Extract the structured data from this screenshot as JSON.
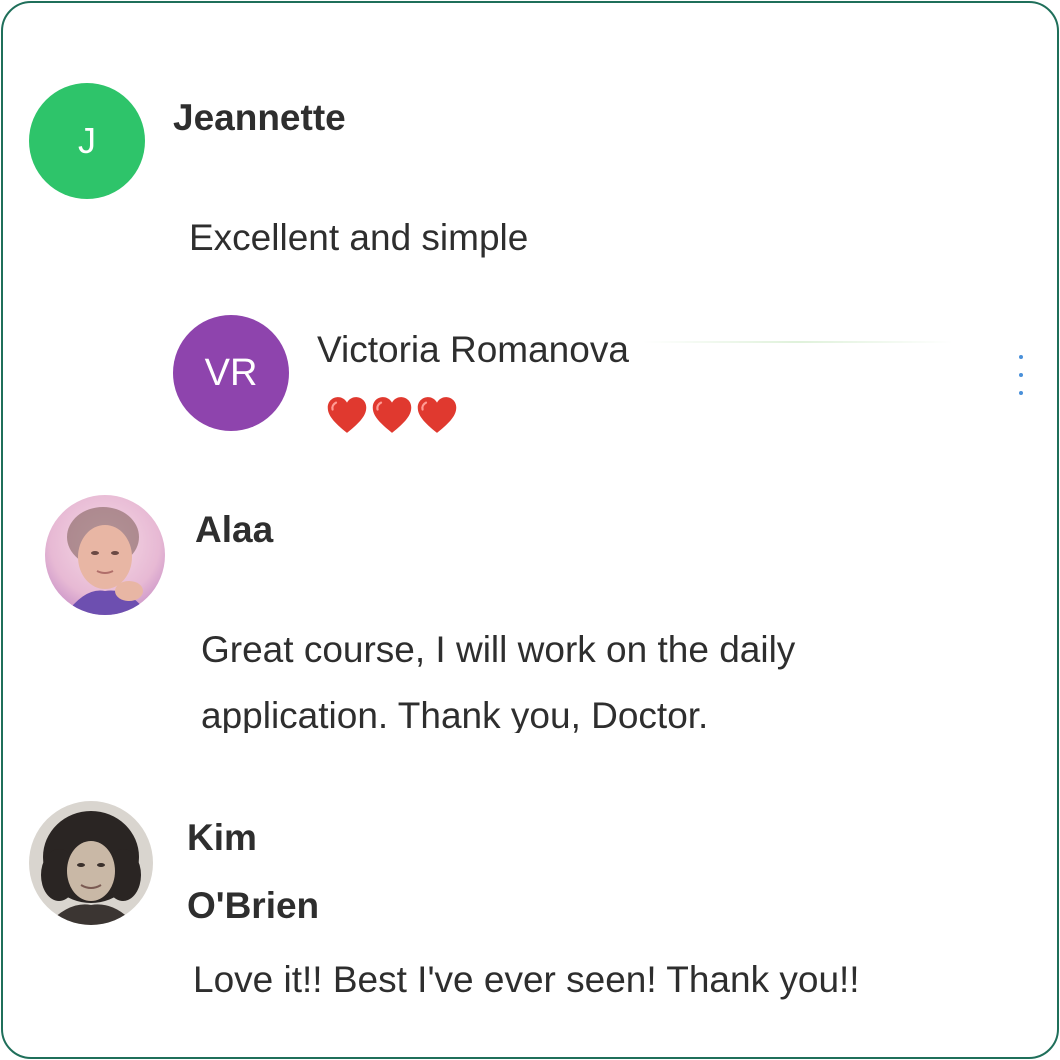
{
  "comments": [
    {
      "author": "Jeannette",
      "avatar_initials": "J",
      "avatar_color": "#2ec46a",
      "text": "Excellent and simple",
      "reply": {
        "author": "Victoria Romanova",
        "avatar_initials": "VR",
        "avatar_color": "#8e44ad",
        "reaction": "❤️❤️❤️",
        "menu_icon": "kebab-menu-icon"
      }
    },
    {
      "author": "Alaa",
      "avatar_type": "photo",
      "text_line1": "Great course, I will work on the daily",
      "text_line2": "application. Thank you, Doctor."
    },
    {
      "author_line1": "Kim",
      "author_line2": "O'Brien",
      "avatar_type": "photo",
      "text": "Love it!! Best I've ever seen! Thank you!!"
    }
  ],
  "colors": {
    "border": "#1f6f5a",
    "accent_menu": "#4a90d9"
  }
}
